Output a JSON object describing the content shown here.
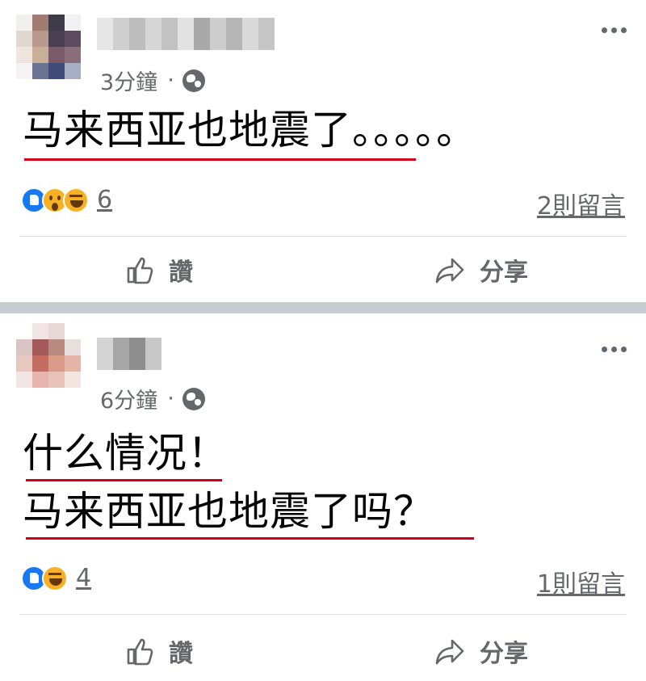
{
  "posts": [
    {
      "timestamp": "3分鐘",
      "separator_dot": "·",
      "text": "马来西亚也地震了。。。。。",
      "reaction_count": "6",
      "comments_label": "2則留言",
      "like_label": "讚",
      "share_label": "分享"
    },
    {
      "timestamp": "6分鐘",
      "separator_dot": "·",
      "text_line1": "什么情况！",
      "text_line2": "马来西亚也地震了吗？",
      "reaction_count": "4",
      "comments_label": "1則留言",
      "like_label": "讚",
      "share_label": "分享"
    }
  ],
  "icons": {
    "privacy": "globe-icon",
    "more": "more-options-icon",
    "like": "thumbs-up-icon",
    "share": "share-arrow-icon",
    "reaction_like": "like-reaction-icon",
    "reaction_wow": "wow-reaction-icon",
    "reaction_haha": "haha-reaction-icon"
  },
  "colors": {
    "underline": "#d0021b",
    "secondary_text": "#65676b",
    "like_blue": "#1877f2",
    "emoji_yellow": "#f7b125",
    "separator": "#c9ccd1"
  }
}
